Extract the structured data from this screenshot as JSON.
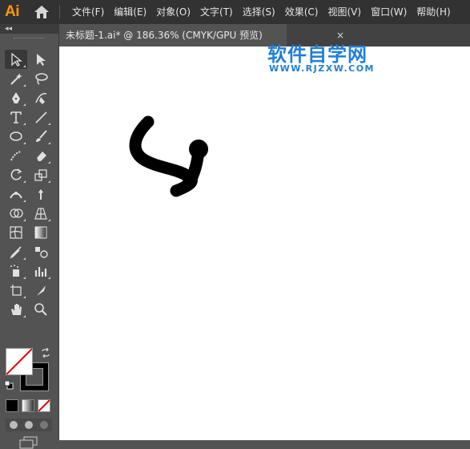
{
  "app": {
    "logo_text": "Ai",
    "accent_color": "#ff9a00"
  },
  "menu": [
    {
      "label": "文件(F)"
    },
    {
      "label": "编辑(E)"
    },
    {
      "label": "对象(O)"
    },
    {
      "label": "文字(T)"
    },
    {
      "label": "选择(S)"
    },
    {
      "label": "效果(C)"
    },
    {
      "label": "视图(V)"
    },
    {
      "label": "窗口(W)"
    },
    {
      "label": "帮助(H)"
    }
  ],
  "toolbar": {
    "collapse_label": "◂◂",
    "rows": [
      [
        "selection-tool",
        "direct-selection-tool"
      ],
      [
        "magic-wand-tool",
        "lasso-tool"
      ],
      [
        "pen-tool",
        "curvature-tool"
      ],
      [
        "type-tool",
        "line-segment-tool"
      ],
      [
        "ellipse-tool",
        "paintbrush-tool"
      ],
      [
        "shaper-tool",
        "eraser-tool"
      ],
      [
        "rotate-tool",
        "scale-tool"
      ],
      [
        "width-tool",
        "puppet-warp-tool"
      ],
      [
        "shape-builder-tool",
        "perspective-grid-tool"
      ],
      [
        "mesh-tool",
        "gradient-tool"
      ],
      [
        "eyedropper-tool",
        "blend-tool"
      ],
      [
        "symbol-sprayer-tool",
        "column-graph-tool"
      ],
      [
        "artboard-tool",
        "slice-tool"
      ],
      [
        "hand-tool",
        "zoom-tool"
      ]
    ],
    "fill_color": "none",
    "stroke_color": "#000000"
  },
  "document": {
    "tab_title": "未标题-1.ai* @ 186.36% (CMYK/GPU 预览)",
    "close_label": "×"
  },
  "canvas": {
    "background": "#ffffff",
    "stroke_color": "#000000"
  },
  "watermark": {
    "title": "软件自学网",
    "url": "WWW.RJZXW.COM",
    "color": "#1e7fd8"
  }
}
